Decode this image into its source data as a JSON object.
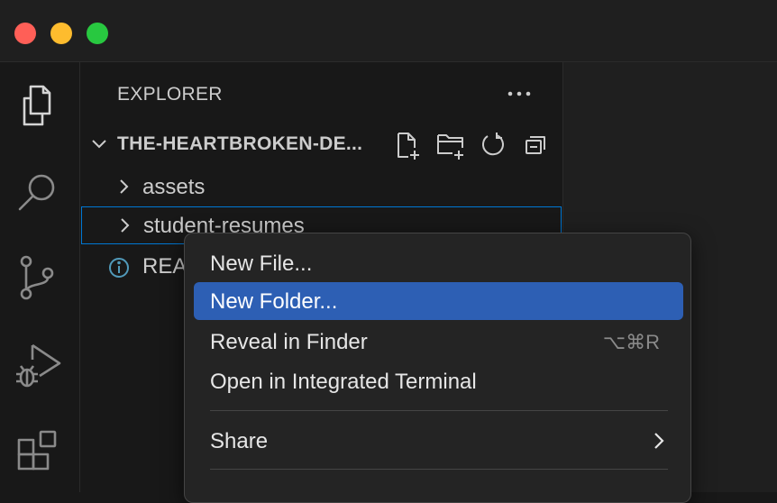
{
  "window": {
    "traffic_lights": [
      {
        "name": "close",
        "color": "#ff5f57"
      },
      {
        "name": "minimize",
        "color": "#febc2e"
      },
      {
        "name": "maximize",
        "color": "#28c840"
      }
    ]
  },
  "activity_bar": {
    "items": [
      {
        "name": "explorer",
        "icon": "files-icon",
        "active": true
      },
      {
        "name": "search",
        "icon": "search-icon"
      },
      {
        "name": "source-control",
        "icon": "source-control-icon"
      },
      {
        "name": "run-and-debug",
        "icon": "run-debug-icon"
      },
      {
        "name": "extensions",
        "icon": "extensions-icon"
      }
    ]
  },
  "sidebar": {
    "title": "EXPLORER",
    "more_icon": "ellipsis-icon",
    "root": {
      "label": "THE-HEARTBROKEN-DE...",
      "actions": [
        {
          "name": "new-file",
          "icon": "new-file-icon"
        },
        {
          "name": "new-folder",
          "icon": "new-folder-icon"
        },
        {
          "name": "refresh",
          "icon": "refresh-icon"
        },
        {
          "name": "collapse-all",
          "icon": "collapse-all-icon"
        }
      ]
    },
    "tree": [
      {
        "label": "assets",
        "type": "folder"
      },
      {
        "label": "student-resumes",
        "type": "folder",
        "selected": true
      },
      {
        "label": "REA",
        "type": "file",
        "icon": "info-icon"
      }
    ]
  },
  "context_menu": {
    "items": [
      {
        "label": "New File...",
        "shortcut": ""
      },
      {
        "label": "New Folder...",
        "shortcut": "",
        "active": true
      },
      {
        "label": "Reveal in Finder",
        "shortcut": "⌥⌘R"
      },
      {
        "label": "Open in Integrated Terminal",
        "shortcut": ""
      },
      {
        "label": "Share",
        "submenu": true
      }
    ]
  },
  "colors": {
    "accent": "#0078d4",
    "menu_highlight": "#2d5fb4",
    "background": "#181818"
  }
}
